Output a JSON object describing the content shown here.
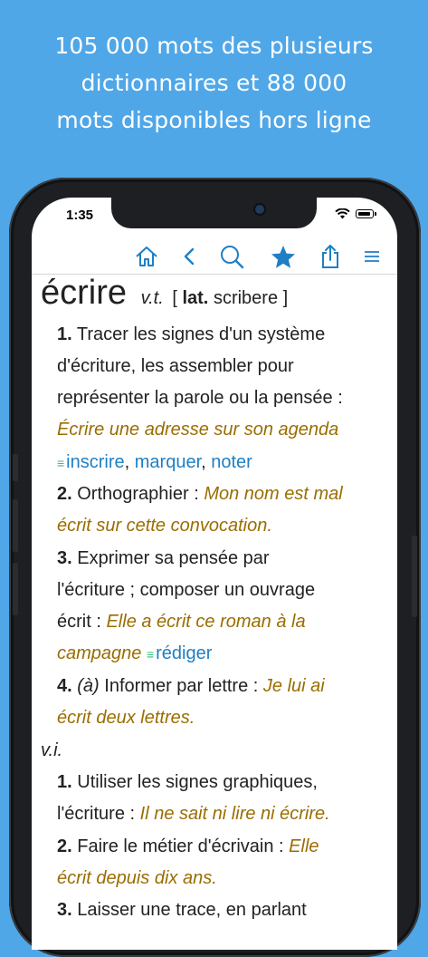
{
  "banner": {
    "line1": "105 000 mots des plusieurs",
    "line2": "dictionnaires et 88 000",
    "line3": "mots disponibles hors ligne"
  },
  "status": {
    "time": "1:35"
  },
  "toolbar": {
    "icons": [
      "home-icon",
      "back-icon",
      "search-icon",
      "star-icon",
      "share-icon",
      "menu-icon"
    ],
    "accent": "#1f7fc4"
  },
  "entry": {
    "headword": "écrire",
    "pos": "v.t.",
    "etym_open": "[",
    "etym_lang": "lat.",
    "etym_word": "scribere",
    "etym_close": "]",
    "s1": {
      "num": "1.",
      "l1": "Tracer les signes d'un système",
      "l2": "d'écriture, les assembler pour",
      "l3": "représenter la parole ou la pensée :",
      "ex": "Écrire une adresse sur son agenda",
      "syn1": "inscrire",
      "sep1": ",",
      "syn2": "marquer",
      "sep2": ",",
      "syn3": "noter"
    },
    "s2": {
      "num": "2.",
      "l1": "Orthographier :",
      "ex1": "Mon nom est mal",
      "ex2": "écrit sur cette convocation."
    },
    "s3": {
      "num": "3.",
      "l1": "Exprimer sa pensée par",
      "l2": "l'écriture ; composer un ouvrage",
      "l3a": "écrit :",
      "ex1": "Elle a écrit ce roman à la",
      "ex2": "campagne",
      "syn1": "rédiger"
    },
    "s4": {
      "num": "4.",
      "paren": "(à)",
      "l1": "Informer par lettre :",
      "ex1": "Je lui ai",
      "ex2": "écrit deux lettres."
    },
    "pos2": "v.i.",
    "i1": {
      "num": "1.",
      "l1": "Utiliser les signes graphiques,",
      "l2a": "l'écriture :",
      "ex": "Il ne sait ni lire ni écrire."
    },
    "i2": {
      "num": "2.",
      "l1": "Faire le métier d'écrivain :",
      "ex1": "Elle",
      "ex2": "écrit depuis dix ans."
    },
    "i3": {
      "num": "3.",
      "l1": "Laisser une trace, en parlant"
    },
    "syn_mark": "≡"
  }
}
